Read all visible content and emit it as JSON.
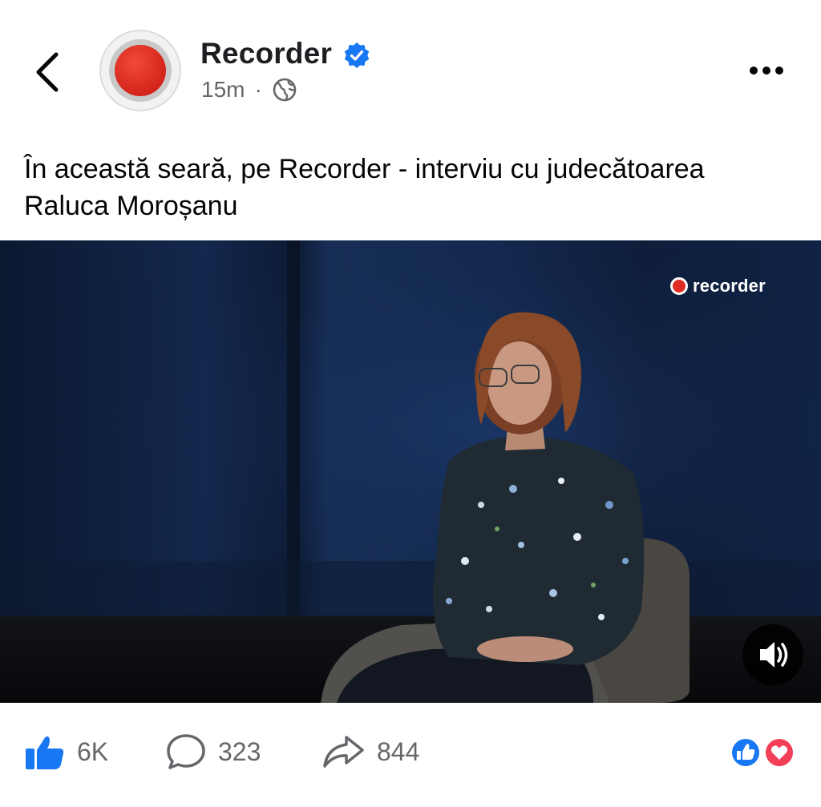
{
  "header": {
    "page_name": "Recorder",
    "time": "15m",
    "separator": "·"
  },
  "icons": {
    "back": "chevron-left-icon",
    "verified": "verified-badge-icon",
    "audience": "globe-icon",
    "more": "more-horizontal-icon",
    "sound": "volume-icon",
    "like": "like-thumb-icon",
    "comment": "comment-bubble-icon",
    "share": "share-arrow-icon"
  },
  "post": {
    "text": "În această seară, pe Recorder - interviu cu judecătoarea Raluca Moroșanu"
  },
  "video": {
    "watermark": "recorder"
  },
  "actions": {
    "likes": "6K",
    "comments": "323",
    "shares": "844"
  },
  "colors": {
    "brand_red": "#d4241a",
    "verified_blue": "#1877f2",
    "like_blue": "#1877f2",
    "love_red": "#f33e58",
    "muted_text": "#65676b"
  }
}
